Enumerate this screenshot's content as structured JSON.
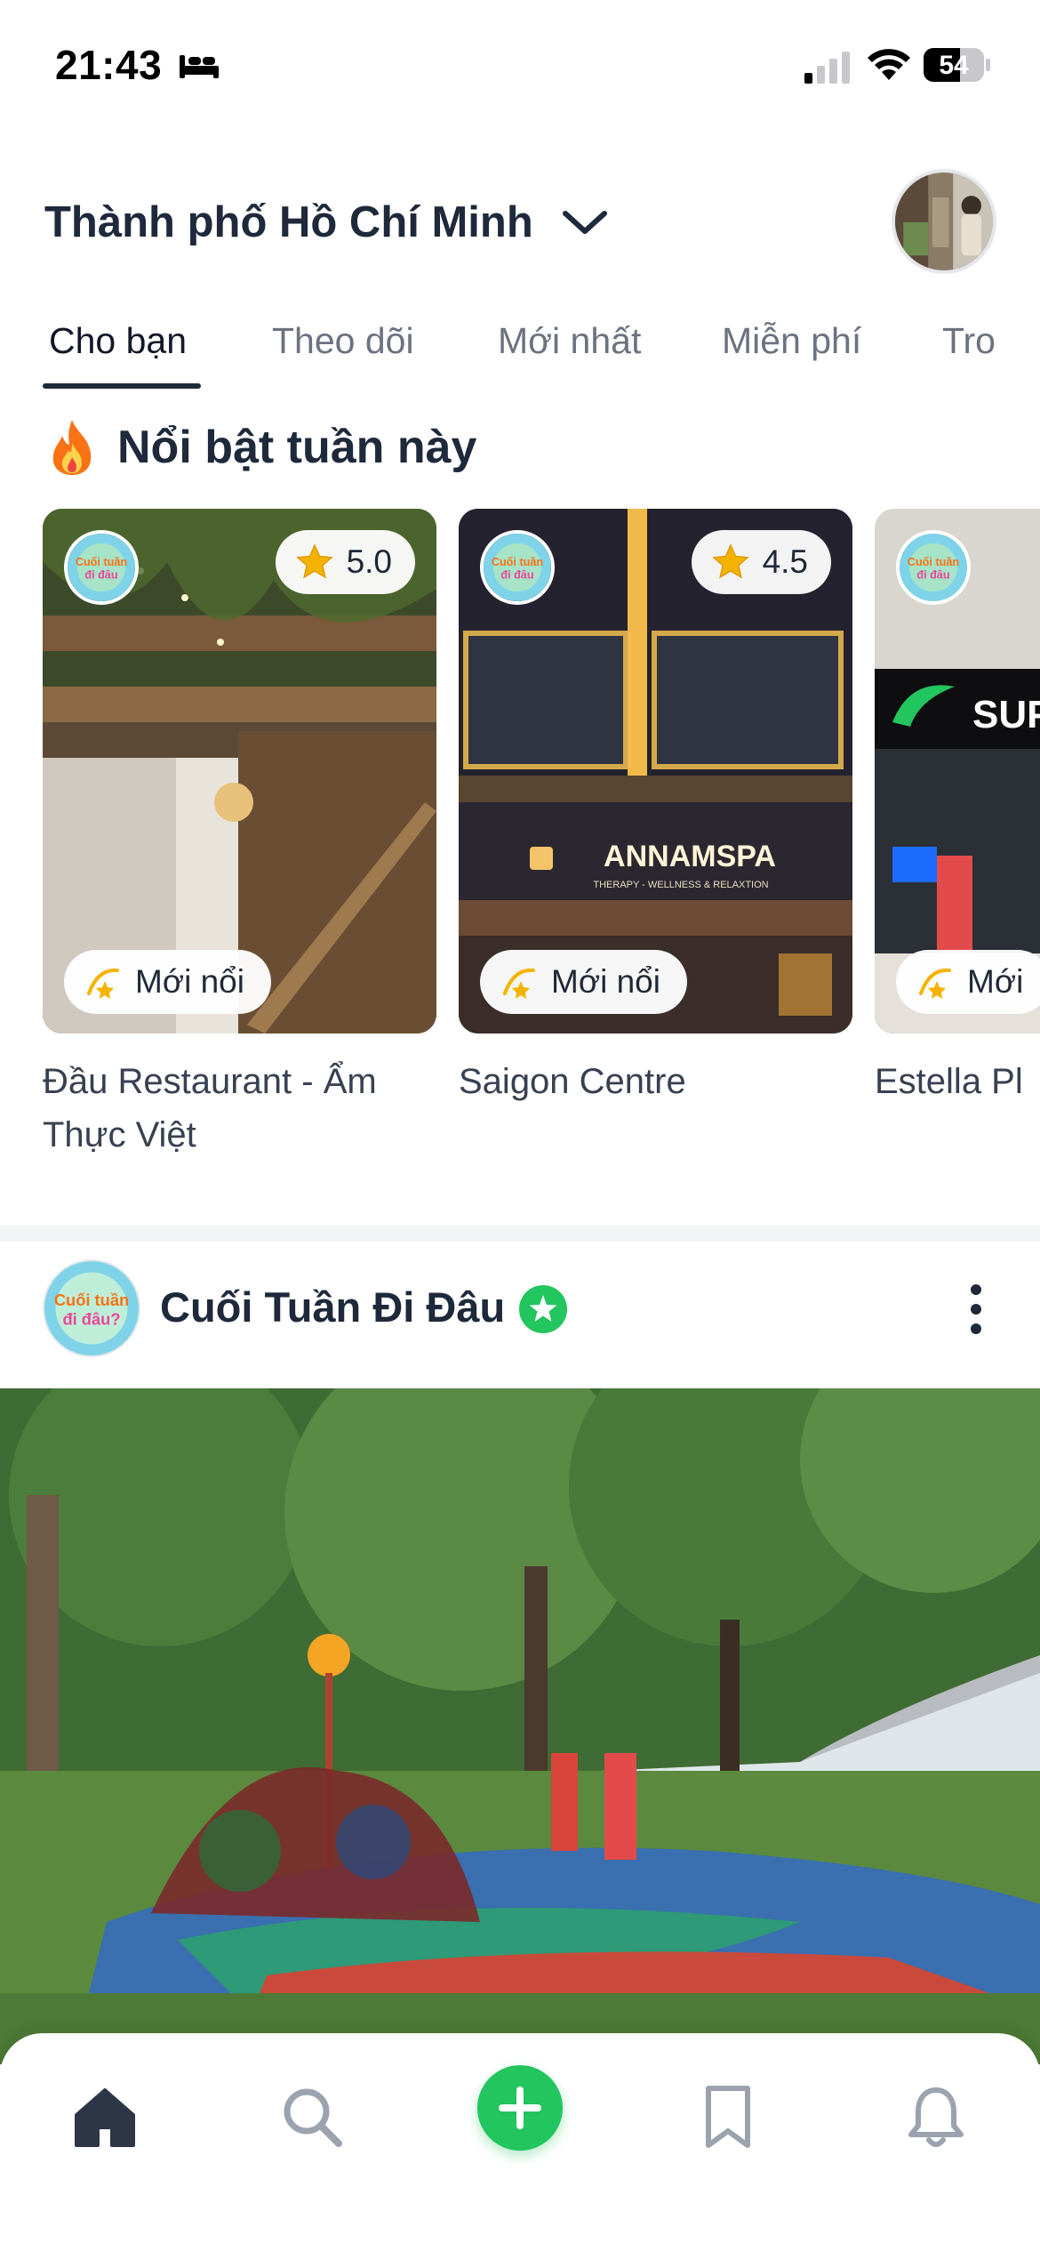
{
  "status_bar": {
    "time": "21:43",
    "battery": "54"
  },
  "header": {
    "city": "Thành phố Hồ Chí Minh"
  },
  "tabs": [
    {
      "label": "Cho bạn",
      "active": true
    },
    {
      "label": "Theo dõi",
      "active": false
    },
    {
      "label": "Mới nhất",
      "active": false
    },
    {
      "label": "Miễn phí",
      "active": false
    },
    {
      "label": "Tro",
      "active": false
    }
  ],
  "featured": {
    "title": "Nổi bật tuần này",
    "cards": [
      {
        "name": "Đầu Restaurant - Ẩm Thực Việt",
        "rating": "5.0",
        "badge": "Mới nổi",
        "logo_text": "Cuối tuần đi đâu"
      },
      {
        "name": "Saigon Centre",
        "rating": "4.5",
        "badge": "Mới nổi",
        "logo_text": "Cuối tuần đi đâu",
        "sign_text": "ANNAMSPA",
        "sign_sub": "THERAPY - WELLNESS & RELAXTION"
      },
      {
        "name": "Estella Pl",
        "rating": "",
        "badge": "Mới",
        "logo_text": "Cuối tuần đi đâu",
        "sign_text": "SUP"
      }
    ]
  },
  "post": {
    "author": "Cuối Tuần Đi Đâu",
    "verified": true
  },
  "bottom_nav": {
    "items": [
      "home-icon",
      "search-icon",
      "add-icon",
      "bookmark-icon",
      "bell-icon"
    ],
    "accent": "#22c55e"
  },
  "colors": {
    "text_primary": "#1e293b",
    "text_muted": "#6b7280",
    "accent_green": "#22c55e",
    "star": "#f5b301"
  }
}
